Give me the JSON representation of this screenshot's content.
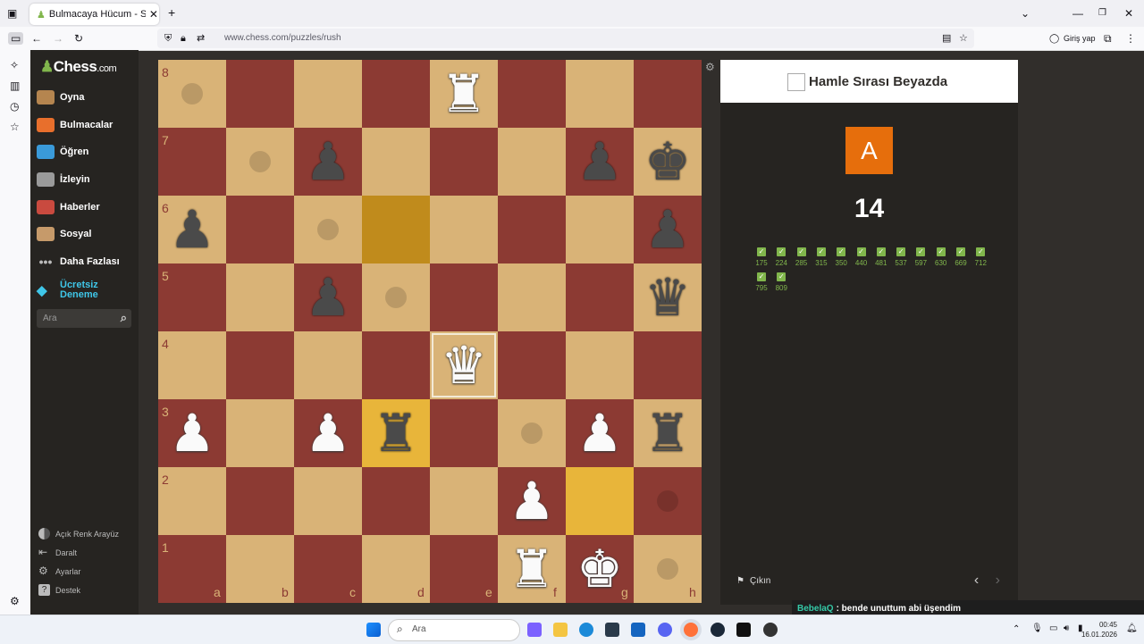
{
  "browser": {
    "tab_title": "Bulmacaya Hücum - Satranç Bu",
    "url": "www.chess.com/puzzles/rush",
    "signin_label": "Giriş yap"
  },
  "nav": {
    "logo_main": "Chess",
    "logo_suffix": ".com",
    "items": [
      {
        "label": "Oyna",
        "icon": "pawn-play-icon"
      },
      {
        "label": "Bulmacalar",
        "icon": "puzzle-icon"
      },
      {
        "label": "Öğren",
        "icon": "learn-cube-icon"
      },
      {
        "label": "İzleyin",
        "icon": "binoculars-icon"
      },
      {
        "label": "Haberler",
        "icon": "news-icon"
      },
      {
        "label": "Sosyal",
        "icon": "social-icon"
      },
      {
        "label": "Daha Fazlası",
        "icon": "more-dots-icon"
      }
    ],
    "trial_line1": "Ücretsiz",
    "trial_line2": "Deneme",
    "search_placeholder": "Ara",
    "bottom": [
      {
        "label": "Açık Renk Arayüz"
      },
      {
        "label": "Daralt"
      },
      {
        "label": "Ayarlar"
      },
      {
        "label": "Destek"
      }
    ]
  },
  "board": {
    "ranks": [
      "8",
      "7",
      "6",
      "5",
      "4",
      "3",
      "2",
      "1"
    ],
    "files": [
      "a",
      "b",
      "c",
      "d",
      "e",
      "f",
      "g",
      "h"
    ],
    "pieces": [
      {
        "sq": "e8",
        "glyph": "♜",
        "color": "w"
      },
      {
        "sq": "c7",
        "glyph": "♟",
        "color": "b"
      },
      {
        "sq": "g7",
        "glyph": "♟",
        "color": "b"
      },
      {
        "sq": "h7",
        "glyph": "♚",
        "color": "b"
      },
      {
        "sq": "a6",
        "glyph": "♟",
        "color": "b"
      },
      {
        "sq": "h6",
        "glyph": "♟",
        "color": "b"
      },
      {
        "sq": "c5",
        "glyph": "♟",
        "color": "b"
      },
      {
        "sq": "h5",
        "glyph": "♛",
        "color": "b"
      },
      {
        "sq": "e4",
        "glyph": "♛",
        "color": "w"
      },
      {
        "sq": "a3",
        "glyph": "♟",
        "color": "w"
      },
      {
        "sq": "c3",
        "glyph": "♟",
        "color": "w"
      },
      {
        "sq": "d3",
        "glyph": "♜",
        "color": "b"
      },
      {
        "sq": "g3",
        "glyph": "♟",
        "color": "w"
      },
      {
        "sq": "h3",
        "glyph": "♜",
        "color": "b"
      },
      {
        "sq": "f2",
        "glyph": "♟",
        "color": "w"
      },
      {
        "sq": "f1",
        "glyph": "♜",
        "color": "w"
      },
      {
        "sq": "g1",
        "glyph": "♚",
        "color": "w"
      }
    ],
    "dots": [
      "a8",
      "b7",
      "c6",
      "d5",
      "f3",
      "h2",
      "h1"
    ],
    "highlights": {
      "d6": "orange",
      "d3": "gold",
      "g2": "gold"
    },
    "selected": "e4"
  },
  "panel": {
    "title": "Hamle Sırası Beyazda",
    "avatar_letter": "A",
    "score": "14",
    "solved": [
      "175",
      "224",
      "285",
      "315",
      "350",
      "440",
      "481",
      "537",
      "597",
      "630",
      "669",
      "712",
      "795",
      "809"
    ],
    "exit_label": "Çıkın"
  },
  "overlay": {
    "user": "BebelaQ",
    "message": ": bende unuttum abi üşendim"
  },
  "taskbar": {
    "search_placeholder": "Ara",
    "time": "00:45",
    "date": "16.01.2026"
  }
}
